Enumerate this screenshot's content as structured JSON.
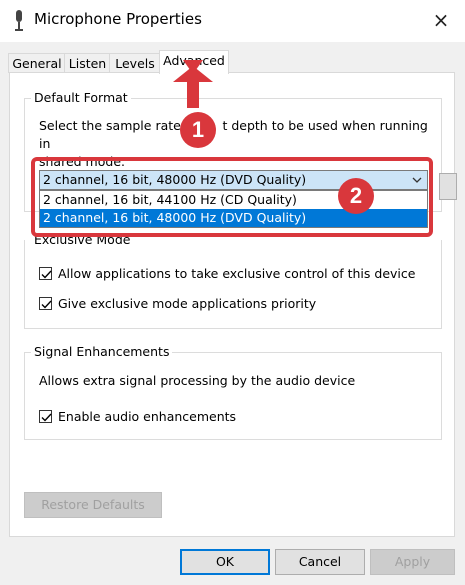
{
  "window": {
    "title": "Microphone Properties",
    "close_icon": "×"
  },
  "tabs": [
    {
      "label": "General"
    },
    {
      "label": "Listen"
    },
    {
      "label": "Levels"
    },
    {
      "label": "Advanced"
    }
  ],
  "active_tab": "Advanced",
  "default_format": {
    "title": "Default Format",
    "description_line1": "Select the sample rate a",
    "description_line1_end": "t depth to be used when running in",
    "description_line2": "shared mode.",
    "selected_value": "2 channel, 16 bit, 48000 Hz (DVD Quality)",
    "options": [
      {
        "label": "2 channel, 16 bit, 44100 Hz (CD Quality)"
      },
      {
        "label": "2 channel, 16 bit, 48000 Hz (DVD Quality)"
      }
    ]
  },
  "exclusive_mode": {
    "title": "Exclusive Mode",
    "allow_control_label": "Allow applications to take exclusive control of this device",
    "allow_control_checked": true,
    "give_priority_label": "Give exclusive mode applications priority",
    "give_priority_checked": true
  },
  "signal_enhancements": {
    "title": "Signal Enhancements",
    "description": "Allows extra signal processing by the audio device",
    "enable_label": "Enable audio enhancements",
    "enable_checked": true
  },
  "buttons": {
    "restore_defaults": "Restore Defaults",
    "ok": "OK",
    "cancel": "Cancel",
    "apply": "Apply"
  },
  "annotations": {
    "badge_1": "1",
    "badge_2": "2",
    "color": "#d9373c"
  }
}
